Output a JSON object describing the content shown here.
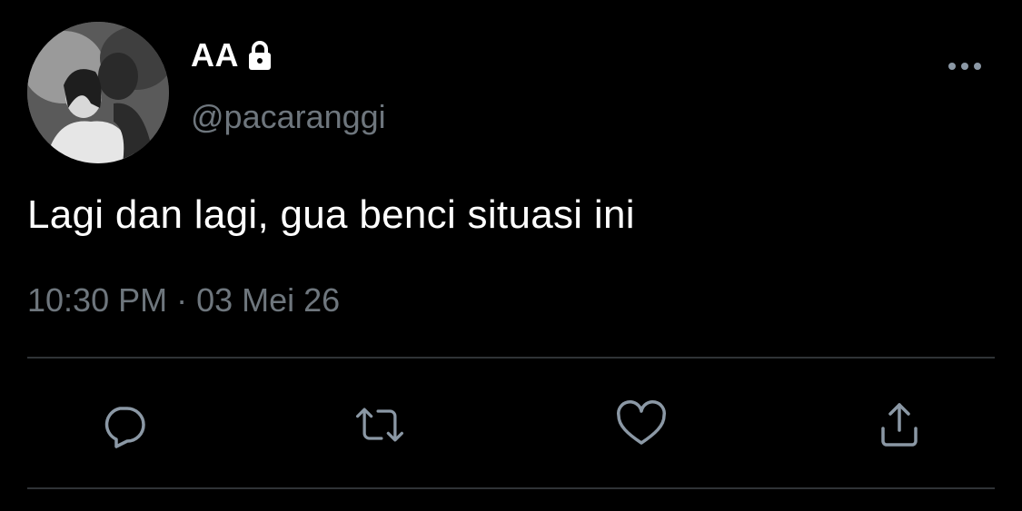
{
  "tweet": {
    "display_name": "AA",
    "handle": "@pacaranggi",
    "text": "Lagi dan lagi, gua benci situasi ini",
    "time": "10:30 PM",
    "separator": "·",
    "date": "03 Mei 26"
  },
  "icons": {
    "lock": "lock-icon",
    "more": "more-icon",
    "reply": "reply-icon",
    "retweet": "retweet-icon",
    "like": "like-icon",
    "share": "share-icon"
  },
  "colors": {
    "background": "#000000",
    "text_primary": "#ffffff",
    "text_secondary": "#6e767d",
    "icon": "#8b98a5",
    "divider": "#2f3336"
  }
}
